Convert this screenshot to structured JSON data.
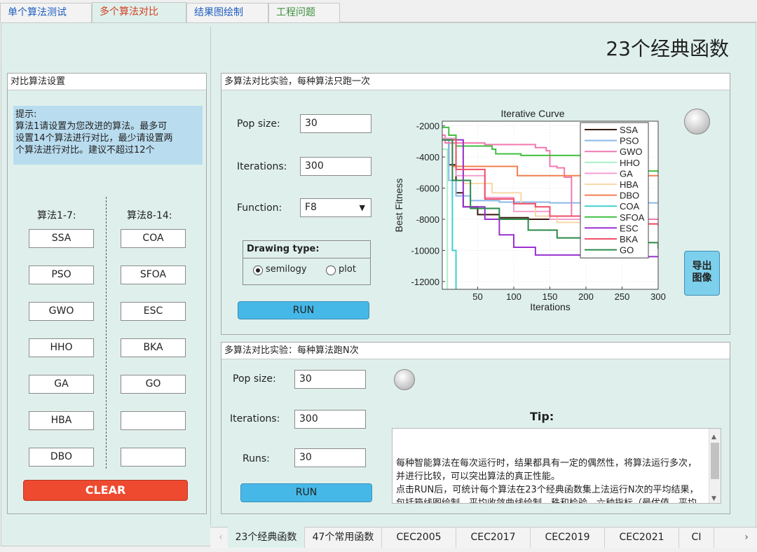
{
  "tabs": [
    "单个算法测试",
    "多个算法对比",
    "结果图绘制",
    "工程问题"
  ],
  "tab_colors": [
    "#1f5fbf",
    "#d04020",
    "#1f5fbf",
    "#3f8f3f"
  ],
  "page_title": "23个经典函数",
  "left_panel": {
    "title": "对比算法设置",
    "hint": "提示:\n算法1请设置为您改进的算法。最多可\n设置14个算法进行对比，最少请设置两\n个算法进行对比。建议不超过12个",
    "col1_label": "算法1-7:",
    "col2_label": "算法8-14:",
    "col1": [
      "SSA",
      "PSO",
      "GWO",
      "HHO",
      "GA",
      "HBA",
      "DBO"
    ],
    "col2": [
      "COA",
      "SFOA",
      "ESC",
      "BKA",
      "GO",
      "",
      ""
    ],
    "clear": "CLEAR"
  },
  "single_panel": {
    "title": "多算法对比实验，每种算法只跑一次",
    "pop_label": "Pop size:",
    "pop_value": "30",
    "iter_label": "Iterations:",
    "iter_value": "300",
    "func_label": "Function:",
    "func_value": "F8",
    "drawing_type_label": "Drawing type:",
    "radio_semilogy": "semilogy",
    "radio_plot": "plot",
    "run": "RUN",
    "export": "导出\n图像"
  },
  "multi_panel": {
    "title": "多算法对比实验：每种算法跑N次",
    "pop_label": "Pop size:",
    "pop_value": "30",
    "iter_label": "Iterations:",
    "iter_value": "300",
    "runs_label": "Runs:",
    "runs_value": "30",
    "run": "RUN",
    "tip_label": "Tip:",
    "tip_text": "每种智能算法在每次运行时，结果都具有一定的偶然性，将算法运行多次，并进行比较，可以突出算法的真正性能。\n点击RUN后，可统计每个算法在23个经典函数集上法运行N次的平均结果，包括箱线图绘制，平均收敛曲线绘制，秩和检验，六种指标（最优值，平均值，方差，最差值，中指，平均运行时间）计算"
  },
  "bottom_tabs": [
    "23个经典函数",
    "47个常用函数",
    "CEC2005",
    "CEC2017",
    "CEC2019",
    "CEC2021",
    "CI"
  ],
  "chart_data": {
    "type": "line",
    "title": "Iterative Curve",
    "xlabel": "Iterations",
    "ylabel": "Best Fitness",
    "xlim": [
      1,
      300
    ],
    "ylim": [
      -12500,
      -1700
    ],
    "xticks": [
      50,
      100,
      150,
      200,
      250,
      300
    ],
    "yticks": [
      -2000,
      -4000,
      -6000,
      -8000,
      -10000,
      -12000
    ],
    "ytick_labels": [
      "-2000",
      "-4000",
      "-6000",
      "-8000",
      "-10000",
      "-12000"
    ],
    "legend_position": "top-right",
    "series": [
      {
        "name": "SSA",
        "color": "#3a1a10",
        "points": [
          [
            1,
            -2900
          ],
          [
            10,
            -4500
          ],
          [
            20,
            -6300
          ],
          [
            30,
            -7200
          ],
          [
            50,
            -7700
          ],
          [
            80,
            -7900
          ],
          [
            120,
            -8000
          ],
          [
            160,
            -8000
          ],
          [
            200,
            -8000
          ],
          [
            300,
            -8000
          ]
        ]
      },
      {
        "name": "PSO",
        "color": "#8ab8e8",
        "points": [
          [
            1,
            -2900
          ],
          [
            10,
            -5500
          ],
          [
            20,
            -6500
          ],
          [
            40,
            -6800
          ],
          [
            80,
            -6900
          ],
          [
            150,
            -6950
          ],
          [
            300,
            -6950
          ]
        ]
      },
      {
        "name": "GWO",
        "color": "#f07ab0",
        "points": [
          [
            1,
            -2600
          ],
          [
            5,
            -3100
          ],
          [
            60,
            -3200
          ],
          [
            100,
            -3200
          ],
          [
            130,
            -3400
          ],
          [
            145,
            -3600
          ],
          [
            150,
            -4600
          ],
          [
            160,
            -4700
          ],
          [
            170,
            -5300
          ],
          [
            180,
            -7800
          ],
          [
            200,
            -8000
          ],
          [
            300,
            -8050
          ]
        ]
      },
      {
        "name": "HHO",
        "color": "#a8f0c8",
        "points": [
          [
            1,
            -3500
          ],
          [
            8,
            -13500
          ]
        ]
      },
      {
        "name": "GA",
        "color": "#f2a0d0",
        "points": [
          [
            1,
            -2800
          ],
          [
            20,
            -5200
          ],
          [
            60,
            -6600
          ],
          [
            100,
            -7500
          ],
          [
            150,
            -8000
          ],
          [
            200,
            -8300
          ],
          [
            300,
            -8400
          ]
        ]
      },
      {
        "name": "HBA",
        "color": "#f8d8a8",
        "points": [
          [
            1,
            -2900
          ],
          [
            30,
            -5700
          ],
          [
            70,
            -6300
          ],
          [
            110,
            -7000
          ],
          [
            130,
            -7800
          ],
          [
            160,
            -8200
          ],
          [
            200,
            -8300
          ],
          [
            300,
            -8400
          ]
        ]
      },
      {
        "name": "DBO",
        "color": "#f08050",
        "points": [
          [
            1,
            -2900
          ],
          [
            15,
            -4600
          ],
          [
            50,
            -4600
          ],
          [
            100,
            -4600
          ],
          [
            105,
            -5200
          ],
          [
            300,
            -5200
          ]
        ]
      },
      {
        "name": "COA",
        "color": "#40d0d0",
        "points": [
          [
            1,
            -2900
          ],
          [
            15,
            -10000
          ],
          [
            20,
            -13500
          ]
        ]
      },
      {
        "name": "SFOA",
        "color": "#40c040",
        "points": [
          [
            1,
            -2100
          ],
          [
            10,
            -2600
          ],
          [
            20,
            -3300
          ],
          [
            70,
            -3500
          ],
          [
            75,
            -3800
          ],
          [
            110,
            -3900
          ],
          [
            200,
            -4600
          ],
          [
            250,
            -4900
          ],
          [
            300,
            -5000
          ]
        ]
      },
      {
        "name": "ESC",
        "color": "#9a30d0",
        "points": [
          [
            1,
            -2900
          ],
          [
            30,
            -7200
          ],
          [
            60,
            -8000
          ],
          [
            80,
            -9000
          ],
          [
            100,
            -9800
          ],
          [
            130,
            -10300
          ],
          [
            200,
            -10400
          ],
          [
            300,
            -10400
          ]
        ]
      },
      {
        "name": "BKA",
        "color": "#f04f6a",
        "points": [
          [
            1,
            -2900
          ],
          [
            20,
            -4800
          ],
          [
            60,
            -6700
          ],
          [
            100,
            -7000
          ],
          [
            130,
            -7200
          ],
          [
            150,
            -7800
          ],
          [
            200,
            -8300
          ],
          [
            300,
            -8400
          ]
        ]
      },
      {
        "name": "GO",
        "color": "#2a8a4a",
        "points": [
          [
            1,
            -2900
          ],
          [
            15,
            -5500
          ],
          [
            40,
            -7300
          ],
          [
            80,
            -8000
          ],
          [
            120,
            -8700
          ],
          [
            160,
            -9200
          ],
          [
            220,
            -9500
          ],
          [
            300,
            -9900
          ]
        ]
      }
    ]
  }
}
